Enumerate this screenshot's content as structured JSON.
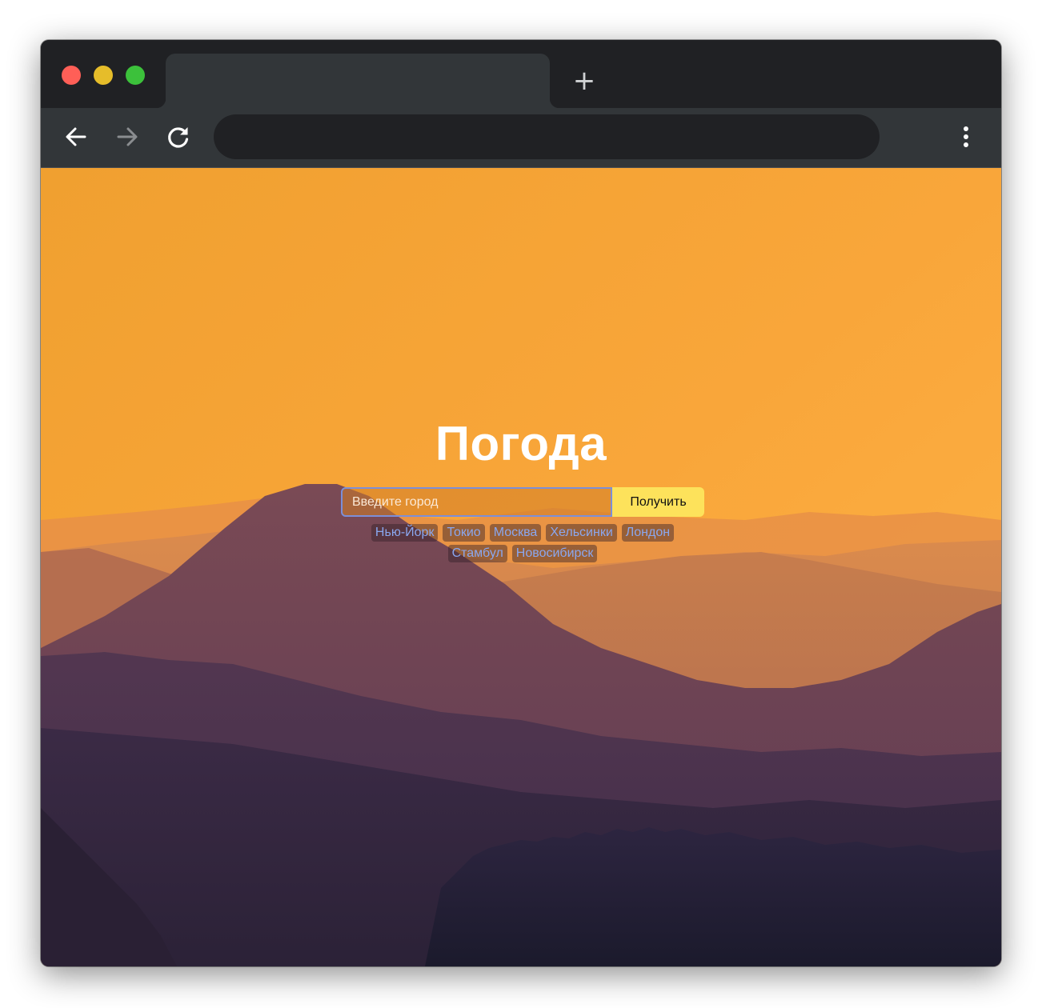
{
  "browser": {
    "tab_title": "",
    "new_tab_symbol": "+",
    "address": "",
    "icons": {
      "back": "arrow-left-icon",
      "forward": "arrow-right-icon",
      "reload": "reload-icon",
      "menu": "kebab-menu-icon"
    }
  },
  "page": {
    "title": "Погода",
    "search": {
      "placeholder": "Введите город",
      "value": "",
      "button_label": "Получить"
    },
    "cities": [
      "Нью-Йорк",
      "Токио",
      "Москва",
      "Хельсинки",
      "Лондон",
      "Стамбул",
      "Новосибирск"
    ]
  },
  "colors": {
    "accent_button": "#fde25b",
    "city_link": "#8aa7ef",
    "input_border": "#7c8fd8"
  }
}
